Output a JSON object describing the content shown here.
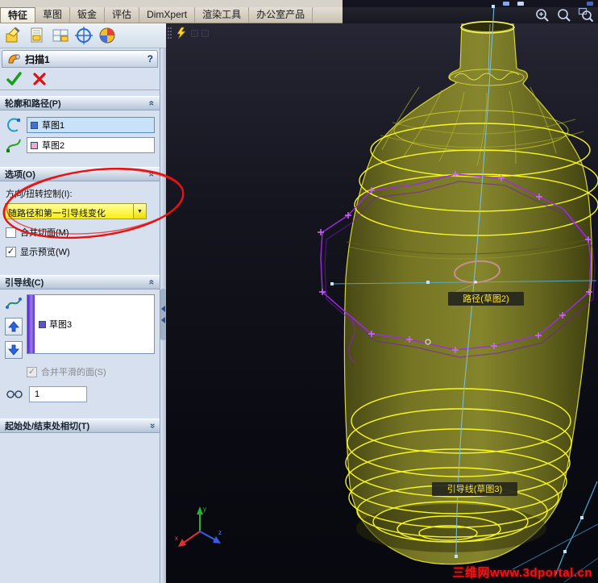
{
  "tabs": [
    "特征",
    "草图",
    "钣金",
    "评估",
    "DimXpert",
    "渲染工具",
    "办公室产品"
  ],
  "icons": {
    "help": "?",
    "dropdown_arrow": "▼",
    "chevron": "«",
    "check": "✓"
  },
  "pm": {
    "title": "扫描1",
    "sections": {
      "profile_path": {
        "header": "轮廓和路径(P)",
        "profile_value": "草图1",
        "path_value": "草图2"
      },
      "options": {
        "header": "选项(O)",
        "direction_label": "方向/扭转控制(I):",
        "direction_value": "随路径和第一引导线变化",
        "merge_tangent_label": "合并切面(M)",
        "show_preview_label": "显示预览(W)"
      },
      "guides": {
        "header": "引导线(C)",
        "item_label": "草图3",
        "merge_smooth_label": "合并平滑的面(S)",
        "sections_value": "1"
      },
      "tangency": {
        "header": "起始处/结束处相切(T)"
      }
    }
  },
  "viewport": {
    "path_label": "路径(草图2)",
    "guide_label": "引导线(草图3)",
    "watermark": "三维网www.3dportal.cn",
    "triad_x": "x",
    "triad_y": "y",
    "triad_z": "z"
  }
}
